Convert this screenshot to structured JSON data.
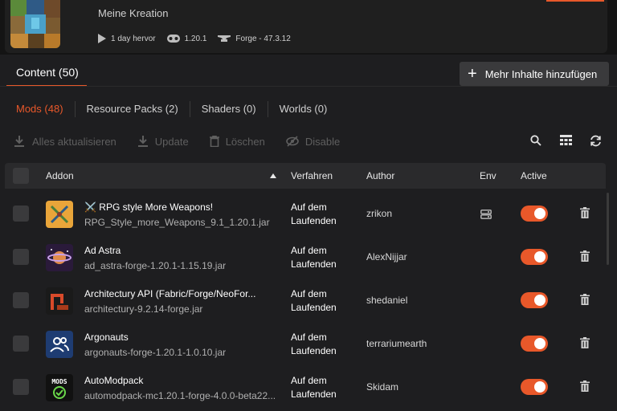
{
  "header": {
    "subtitle": "Meine Kreation",
    "meta": {
      "played": "1 day hervor",
      "version": "1.20.1",
      "loader": "Forge - 47.3.12"
    }
  },
  "tabs": {
    "content_label": "Content (50)",
    "add_button_label": "Mehr Inhalte hinzufügen"
  },
  "filters": [
    {
      "label": "Mods (48)"
    },
    {
      "label": "Resource Packs (2)"
    },
    {
      "label": "Shaders (0)"
    },
    {
      "label": "Worlds (0)"
    }
  ],
  "actions": {
    "update_all": "Alles aktualisieren",
    "update": "Update",
    "delete": "Löschen",
    "disable": "Disable"
  },
  "table": {
    "columns": {
      "addon": "Addon",
      "procedure": "Verfahren",
      "author": "Author",
      "env": "Env",
      "active": "Active"
    },
    "rows": [
      {
        "name": "⚔️ RPG style More Weapons!",
        "file": "RPG_Style_more_Weapons_9.1_1.20.1.jar",
        "proc1": "Auf dem",
        "proc2": "Laufenden",
        "author": "zrikon",
        "env": "server-icon",
        "active": true
      },
      {
        "name": "Ad Astra",
        "file": "ad_astra-forge-1.20.1-1.15.19.jar",
        "proc1": "Auf dem",
        "proc2": "Laufenden",
        "author": "AlexNijjar",
        "active": true
      },
      {
        "name": "Architectury API (Fabric/Forge/NeoFor...",
        "file": "architectury-9.2.14-forge.jar",
        "proc1": "Auf dem",
        "proc2": "Laufenden",
        "author": "shedaniel",
        "active": true
      },
      {
        "name": "Argonauts",
        "file": "argonauts-forge-1.20.1-1.0.10.jar",
        "proc1": "Auf dem",
        "proc2": "Laufenden",
        "author": "terrariumearth",
        "active": true
      },
      {
        "name": "AutoModpack",
        "file": "automodpack-mc1.20.1-forge-4.0.0-beta22...",
        "proc1": "Auf dem",
        "proc2": "Laufenden",
        "author": "Skidam",
        "active": true
      }
    ]
  },
  "colors": {
    "accent": "#e8582a",
    "background": "#1e1e20",
    "header_row": "#2a2a2c"
  }
}
